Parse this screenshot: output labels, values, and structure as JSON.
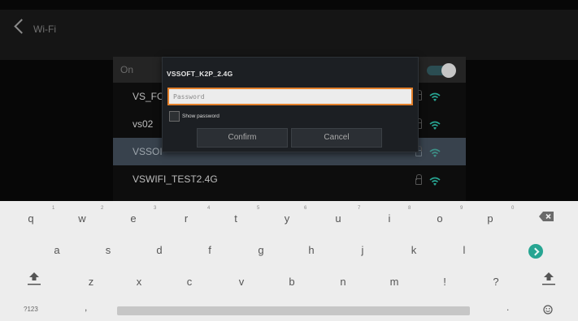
{
  "header": {
    "title": "Wi-Fi"
  },
  "wifi_list": {
    "on_label": "On",
    "networks": [
      {
        "ssid": "VS_FO",
        "secured": true
      },
      {
        "ssid": "vs02",
        "secured": true
      },
      {
        "ssid": "VSSOI",
        "secured": true,
        "selected": true
      },
      {
        "ssid": "VSWIFI_TEST2.4G",
        "secured": true
      }
    ]
  },
  "dialog": {
    "title": "VSSOFT_K2P_2.4G",
    "password_value": "",
    "password_placeholder": "Password",
    "show_password_label": "Show password",
    "show_password_checked": false,
    "confirm_label": "Confirm",
    "cancel_label": "Cancel"
  },
  "keyboard": {
    "row1": [
      {
        "key": "q",
        "hint": "1"
      },
      {
        "key": "w",
        "hint": "2"
      },
      {
        "key": "e",
        "hint": "3"
      },
      {
        "key": "r",
        "hint": "4"
      },
      {
        "key": "t",
        "hint": "5"
      },
      {
        "key": "y",
        "hint": "6"
      },
      {
        "key": "u",
        "hint": "7"
      },
      {
        "key": "i",
        "hint": "8"
      },
      {
        "key": "o",
        "hint": "9"
      },
      {
        "key": "p",
        "hint": "0"
      }
    ],
    "row2": [
      "a",
      "s",
      "d",
      "f",
      "g",
      "h",
      "j",
      "k",
      "l"
    ],
    "row3": [
      "z",
      "x",
      "c",
      "v",
      "b",
      "n",
      "m",
      "!",
      "?"
    ],
    "symbols_key": "?123",
    "comma_key": ",",
    "period_key": ".",
    "colors": {
      "enter": "#27a592",
      "focus_border": "#e3802b"
    }
  }
}
